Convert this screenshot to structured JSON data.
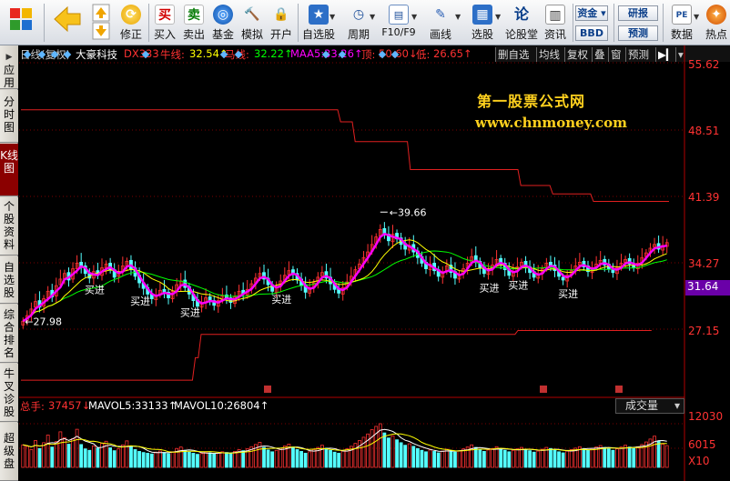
{
  "toolbar": {
    "buttons": [
      {
        "label": "",
        "icon": "app-grid-icon"
      },
      {
        "label": "",
        "icon": "back-arrow-icon"
      },
      {
        "label": "修正",
        "icon": "fix-icon"
      },
      {
        "label": "买入",
        "icon": "buy-icon",
        "glyph": "买"
      },
      {
        "label": "卖出",
        "icon": "sell-icon",
        "glyph": "卖"
      },
      {
        "label": "基金",
        "icon": "fund-icon"
      },
      {
        "label": "模拟",
        "icon": "simulate-icon"
      },
      {
        "label": "开户",
        "icon": "lock-icon"
      },
      {
        "label": "自选股",
        "icon": "favorite-stocks-icon"
      },
      {
        "label": "周期",
        "icon": "period-icon"
      },
      {
        "label": "F10/F9",
        "icon": "f10-icon"
      },
      {
        "label": "画线",
        "icon": "draw-line-icon"
      },
      {
        "label": "选股",
        "icon": "stock-picker-icon"
      },
      {
        "label": "论股堂",
        "icon": "forum-icon",
        "glyph": "论"
      },
      {
        "label": "资讯",
        "icon": "news-icon"
      },
      {
        "label": "数据",
        "icon": "pe-icon",
        "glyph": "PE"
      },
      {
        "label": "热点",
        "icon": "hotspot-icon"
      }
    ],
    "mini": [
      "资金",
      "BBD",
      "研报",
      "预测"
    ]
  },
  "left_tabs": [
    "应用",
    "分时图",
    "K线图",
    "个股资料",
    "自选股",
    "综合排名",
    "牛叉诊股",
    "超级盘"
  ],
  "header": {
    "period": "日线(复权)",
    "stock": "大豪科技",
    "indicator": "DX333",
    "bull_label": "牛线:",
    "bull_value": "32.54↑",
    "horse_label": "马线:",
    "horse_value": "32.22↑",
    "maa5_label": "MAA5:",
    "maa5_value": "33.26↑",
    "top_label": "顶:",
    "top_value": "50.60↓",
    "bottom_label": "低:",
    "bottom_value": "26.65↑",
    "buttons": [
      "删自选",
      "均线",
      "复权",
      "叠",
      "窗",
      "预测"
    ]
  },
  "price_axis": [
    "55.62",
    "48.51",
    "41.39",
    "34.27",
    "31.64",
    "27.15"
  ],
  "watermark": {
    "line1": "第一股票公式网",
    "line2": "www.chnmoney.com"
  },
  "annotations": {
    "high": "39.66",
    "low": "27.98",
    "buy_label": "买进"
  },
  "volume": {
    "total_label": "总手:",
    "total_value": "37457↓",
    "mavol5_label": "MAVOL5:",
    "mavol5_value": "33133↑",
    "mavol10_label": "MAVOL10:",
    "mavol10_value": "26804↑",
    "selector": "成交量",
    "axis": [
      "12030",
      "6015",
      "X10"
    ]
  },
  "colors": {
    "up": "#ff3232",
    "down": "#54ffff",
    "ma": "#ff00ff",
    "bull": "#ffff00",
    "horse": "#00ff00",
    "band": "#e02020"
  },
  "chart_data": {
    "type": "candlestick",
    "title": "日线(复权) 大豪科技",
    "ylim": [
      26.0,
      57.0
    ],
    "price_ticks": [
      55.62,
      48.51,
      41.39,
      34.27,
      27.15
    ],
    "last_price": 31.64,
    "high_label": 39.66,
    "low_label": 27.98,
    "band_upper": [
      50.6,
      50.6,
      50.6,
      50.6,
      50.6,
      50.6,
      50.6,
      50.6,
      50.6,
      50.6,
      50.6,
      50.6,
      50.6,
      50.6,
      50.6,
      50.6,
      50.6,
      50.6,
      50.6,
      50.6,
      50.6,
      50.6,
      50.6,
      50.6,
      50.6,
      50.6,
      50.6,
      50.6,
      50.6,
      50.6,
      50.6,
      50.6,
      50.6,
      50.6,
      50.6,
      50.6,
      50.6,
      50.6,
      50.6,
      50.6,
      50.6,
      50.6,
      50.6,
      50.6,
      50.6,
      50.6,
      50.6,
      50.6,
      50.6,
      50.6,
      50.6,
      50.6,
      50.6,
      50.6,
      50.6,
      50.6,
      50.6,
      50.6,
      50.6,
      50.6,
      50.6,
      50.6,
      50.6,
      50.6,
      50.6,
      50.6,
      50.6,
      50.6,
      50.6,
      50.6,
      50.6,
      50.6,
      50.6,
      50.6,
      50.6,
      50.6,
      50.6,
      50.6,
      50.6,
      50.6,
      50.6,
      50.6,
      50.6,
      50.6,
      50.6,
      50.6,
      50.6,
      50.6,
      50.6,
      50.6,
      50.6,
      50.6,
      50.6,
      50.6,
      50.6,
      50.6,
      50.6,
      50.6,
      50.6,
      50.6,
      50.6,
      50.6,
      50.6,
      50.6,
      50.6,
      50.6,
      50.6,
      50.6,
      50.6,
      50.6,
      49.3,
      49.3,
      49.3,
      49.3,
      49.3,
      47.2,
      47.2,
      47.2,
      47.2,
      47.2,
      47.2,
      47.2,
      47.2,
      47.2,
      47.2,
      47.2,
      47.2,
      47.2,
      47.2,
      47.2,
      47.2,
      47.2,
      47.2,
      47.2,
      44.2,
      44.2,
      44.2,
      44.2,
      44.2,
      44.2,
      44.2,
      44.2,
      44.2,
      44.2,
      44.2,
      44.2,
      44.2,
      44.2,
      44.2,
      44.2,
      44.2,
      44.2,
      44.2,
      44.2,
      44.2,
      44.2,
      44.2,
      44.2,
      44.2,
      44.2,
      44.2,
      44.2,
      44.2,
      44.2,
      44.2,
      44.2,
      44.2,
      44.2,
      44.2,
      44.2,
      44.2,
      44.2,
      42.5,
      42.5,
      42.5,
      42.5,
      42.5,
      42.5,
      42.5,
      42.5,
      42.5,
      42.5,
      42.5,
      41.6,
      41.6,
      41.6,
      41.6,
      41.6,
      41.6,
      41.6,
      41.6,
      41.6,
      41.6,
      41.6,
      41.6,
      41.6,
      41.6,
      40.8,
      40.8,
      40.8,
      40.8,
      40.8,
      40.8,
      40.8,
      40.8,
      40.8,
      40.8,
      40.8,
      40.8,
      40.8,
      40.8,
      40.8,
      40.8,
      40.8,
      40.8,
      40.8,
      40.8,
      40.8,
      40.8,
      40.8,
      40.8,
      40.8,
      40.8,
      40.8
    ],
    "band_lower": [
      21.7,
      21.7,
      21.7,
      21.7,
      21.7,
      21.7,
      21.7,
      21.7,
      21.7,
      21.7,
      21.7,
      21.7,
      21.7,
      21.7,
      21.7,
      21.7,
      21.7,
      21.7,
      21.7,
      21.7,
      21.7,
      21.7,
      21.7,
      21.7,
      21.7,
      21.7,
      21.7,
      21.7,
      21.7,
      21.7,
      21.7,
      21.7,
      21.7,
      21.7,
      21.7,
      21.7,
      21.7,
      21.7,
      21.7,
      21.7,
      21.7,
      21.7,
      21.7,
      21.7,
      21.7,
      21.7,
      21.7,
      21.7,
      21.7,
      21.7,
      21.7,
      21.7,
      21.7,
      21.7,
      21.7,
      21.7,
      21.7,
      21.7,
      21.7,
      21.7,
      24.1,
      24.1,
      26.6,
      26.6,
      26.6,
      26.6,
      26.6,
      26.6,
      26.6,
      26.6,
      26.6,
      26.6,
      26.6,
      26.6,
      26.6,
      26.6,
      26.6,
      26.6,
      26.6,
      26.6,
      26.6,
      26.6,
      26.6,
      26.6,
      26.6,
      26.6,
      26.6,
      26.6,
      26.6,
      26.6,
      26.6,
      26.6,
      26.6,
      26.6,
      26.6,
      26.6,
      26.6,
      26.6,
      26.6,
      26.6,
      26.6,
      26.6,
      26.6,
      26.6,
      26.6,
      26.6,
      26.6,
      26.6,
      26.6,
      26.6,
      26.6,
      26.6,
      26.6,
      26.6,
      26.6,
      26.6,
      26.6,
      26.6,
      26.6,
      26.6,
      26.6,
      26.6,
      26.6,
      26.6,
      26.6,
      26.6,
      26.6,
      26.6,
      26.6,
      26.6,
      26.6,
      26.6,
      26.6,
      26.6,
      26.6,
      26.6,
      26.6,
      26.6,
      26.6,
      26.6,
      26.6,
      26.6,
      26.6,
      26.6,
      26.6,
      26.6,
      26.6,
      26.6,
      26.6,
      26.6,
      26.6,
      26.6,
      26.6,
      26.6,
      26.6,
      26.6,
      26.6,
      26.6,
      26.6,
      26.6,
      26.6,
      26.6,
      26.6,
      26.6,
      26.6,
      26.6,
      26.6,
      26.6,
      26.6,
      26.6,
      26.6,
      27.0,
      27.0,
      27.0,
      27.0,
      27.0,
      27.0,
      27.0,
      27.0,
      27.0,
      27.0,
      27.0,
      27.0,
      27.0,
      27.0,
      27.0,
      27.0,
      27.0,
      27.0,
      27.0,
      27.0,
      27.0,
      27.0,
      27.0,
      27.0,
      27.0,
      27.0,
      27.0,
      27.0,
      27.0,
      27.0,
      27.0,
      27.0,
      27.0,
      27.0,
      27.0,
      27.0,
      27.0,
      27.0,
      27.0,
      27.0,
      27.0,
      27.0,
      27.0,
      27.0,
      27.0,
      27.0,
      27.0
    ],
    "closes": [
      28.0,
      28.6,
      29.3,
      30.1,
      29.5,
      30.4,
      31.2,
      30.6,
      31.8,
      32.5,
      33.1,
      32.4,
      33.6,
      34.2,
      33.8,
      33.1,
      32.6,
      33.3,
      32.9,
      33.7,
      34.1,
      33.5,
      32.7,
      33.2,
      33.9,
      34.4,
      33.6,
      32.8,
      32.1,
      31.5,
      30.9,
      30.4,
      30.8,
      31.3,
      31.0,
      30.5,
      31.2,
      31.9,
      32.3,
      31.6,
      30.9,
      30.2,
      29.6,
      29.9,
      30.5,
      30.1,
      29.7,
      30.2,
      30.7,
      30.4,
      30.0,
      30.6,
      31.2,
      30.9,
      31.4,
      32.0,
      32.6,
      33.1,
      32.5,
      31.9,
      31.2,
      31.7,
      32.3,
      32.9,
      33.4,
      33.0,
      32.4,
      31.8,
      31.1,
      31.5,
      32.1,
      32.7,
      33.2,
      32.6,
      32.0,
      31.4,
      31.0,
      31.6,
      32.2,
      32.8,
      33.5,
      34.1,
      34.8,
      35.4,
      36.2,
      37.0,
      37.8,
      37.2,
      36.6,
      37.3,
      36.8,
      36.2,
      35.7,
      36.1,
      35.4,
      34.8,
      34.2,
      33.6,
      34.1,
      33.4,
      32.8,
      33.3,
      33.9,
      33.2,
      32.6,
      33.0,
      33.6,
      34.2,
      34.9,
      34.3,
      33.7,
      33.1,
      33.5,
      34.0,
      34.6,
      34.1,
      33.5,
      32.9,
      33.3,
      33.8,
      34.3,
      33.7,
      33.2,
      32.7,
      33.0,
      33.6,
      34.2,
      33.9,
      33.4,
      32.8,
      32.4,
      32.9,
      33.4,
      33.9,
      34.3,
      33.8,
      33.3,
      33.7,
      34.1,
      34.5,
      34.0,
      33.6,
      33.2,
      33.7,
      34.2,
      34.6,
      34.1,
      33.7,
      34.2,
      34.8,
      35.3,
      35.8,
      36.2,
      35.7,
      36.1,
      36.4
    ],
    "opens": [
      27.6,
      28.1,
      28.7,
      29.5,
      30.2,
      29.6,
      30.5,
      31.3,
      30.7,
      31.9,
      32.5,
      33.2,
      32.5,
      33.6,
      34.3,
      33.9,
      33.1,
      32.6,
      33.4,
      32.9,
      33.7,
      34.2,
      33.5,
      32.8,
      33.3,
      33.9,
      34.5,
      33.7,
      32.9,
      32.1,
      31.6,
      30.9,
      30.3,
      30.9,
      31.4,
      31.1,
      30.4,
      31.2,
      31.9,
      32.4,
      31.7,
      30.9,
      30.3,
      29.5,
      30.0,
      30.6,
      30.2,
      29.6,
      30.3,
      30.8,
      30.5,
      29.9,
      30.7,
      31.3,
      30.8,
      31.5,
      32.1,
      32.7,
      33.2,
      32.6,
      31.9,
      31.1,
      31.8,
      32.4,
      33.0,
      33.5,
      33.1,
      32.5,
      31.9,
      31.0,
      31.6,
      32.2,
      32.8,
      33.3,
      32.7,
      32.1,
      31.5,
      30.9,
      31.7,
      32.3,
      32.9,
      33.6,
      34.2,
      34.9,
      35.5,
      36.3,
      37.1,
      37.9,
      37.3,
      36.5,
      37.4,
      36.9,
      36.3,
      35.6,
      36.2,
      35.5,
      34.9,
      34.3,
      33.5,
      34.2,
      33.5,
      32.7,
      33.4,
      34.0,
      33.3,
      32.5,
      33.1,
      33.7,
      34.3,
      35.0,
      34.4,
      33.8,
      33.0,
      33.6,
      34.1,
      34.7,
      34.2,
      33.6,
      32.8,
      33.4,
      33.9,
      34.4,
      33.8,
      33.3,
      32.6,
      33.1,
      33.7,
      34.3,
      34.0,
      33.5,
      32.7,
      32.3,
      33.0,
      33.5,
      34.0,
      34.4,
      33.9,
      33.2,
      33.8,
      34.2,
      34.6,
      34.1,
      33.5,
      33.1,
      33.8,
      34.3,
      34.7,
      34.0,
      33.6,
      34.3,
      34.9,
      35.4,
      35.9,
      36.3,
      35.6,
      36.0
    ],
    "volume_ylim": [
      0,
      12500
    ],
    "volume_ticks": [
      12030,
      6015
    ],
    "volumes": [
      6200,
      5800,
      4900,
      7400,
      5200,
      6800,
      8900,
      5600,
      7100,
      9800,
      8200,
      6400,
      7900,
      10500,
      6300,
      5100,
      4700,
      5900,
      5300,
      6600,
      7200,
      5400,
      4600,
      5100,
      6200,
      7300,
      5800,
      4900,
      4400,
      4100,
      3900,
      3700,
      4200,
      4500,
      4100,
      3800,
      4300,
      5200,
      5600,
      4700,
      4200,
      3900,
      3600,
      3800,
      4200,
      4000,
      3700,
      3900,
      4300,
      4100,
      3800,
      4400,
      4900,
      4600,
      5100,
      5700,
      6300,
      6900,
      5500,
      4800,
      4300,
      4700,
      5300,
      5900,
      6400,
      5600,
      4900,
      4400,
      3900,
      4300,
      4900,
      5500,
      6100,
      5300,
      4700,
      4200,
      3900,
      4500,
      5100,
      5800,
      6600,
      7400,
      8300,
      9200,
      10400,
      11300,
      12030,
      9500,
      8100,
      8700,
      7600,
      6800,
      6100,
      6500,
      5800,
      5200,
      4700,
      4300,
      4800,
      4400,
      4000,
      4500,
      5000,
      4600,
      4200,
      4600,
      5100,
      5600,
      6200,
      5500,
      4900,
      4400,
      4800,
      5200,
      5700,
      5200,
      4700,
      4300,
      4700,
      5100,
      5500,
      5000,
      4600,
      4200,
      4500,
      5000,
      5500,
      5200,
      4800,
      4300,
      4000,
      4500,
      4900,
      5300,
      5700,
      5200,
      4800,
      5200,
      5600,
      6000,
      5500,
      5100,
      4700,
      5100,
      5600,
      6100,
      5600,
      5200,
      5700,
      6300,
      7000,
      7800,
      8600,
      7200,
      6400,
      6000
    ]
  }
}
